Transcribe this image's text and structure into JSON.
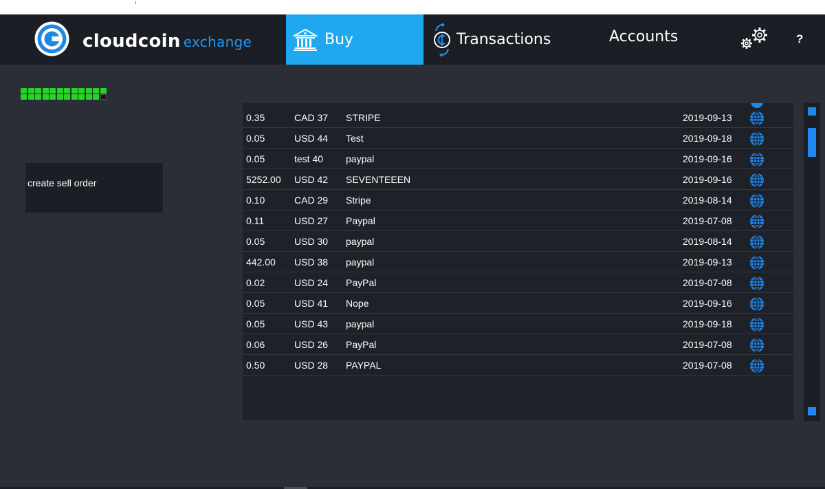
{
  "brand": {
    "name": "cloudcoin",
    "sub": "exchange"
  },
  "nav": {
    "buy_label": "Buy",
    "transactions_label": "Transactions",
    "accounts_label": "Accounts",
    "help_label": "?"
  },
  "icons": {
    "logo": "cloudcoin-logo-icon",
    "buy": "bank-icon",
    "transactions": "coin-exchange-icon",
    "settings": "gear-icon",
    "row_action": "globe-icon"
  },
  "colors": {
    "accent": "#1fa7f0",
    "navbar": "#1b1e25",
    "background": "#2b2e37",
    "progress": "#22d623"
  },
  "progress": {
    "filled": 23,
    "total": 24
  },
  "sell_order": {
    "label": "create sell order"
  },
  "orders": [
    {
      "amount": "0.35",
      "currency": "CAD 37",
      "method": "STRIPE",
      "date": "2019-09-13"
    },
    {
      "amount": "0.05",
      "currency": "USD 44",
      "method": "Test",
      "date": "2019-09-18"
    },
    {
      "amount": "0.05",
      "currency": "test  40",
      "method": "paypal",
      "date": "2019-09-16"
    },
    {
      "amount": "5252.00",
      "currency": "USD 42",
      "method": "SEVENTEEEN",
      "date": "2019-09-16"
    },
    {
      "amount": "0.10",
      "currency": "CAD 29",
      "method": "Stripe",
      "date": "2019-08-14"
    },
    {
      "amount": "0.11",
      "currency": "USD 27",
      "method": "Paypal",
      "date": "2019-07-08"
    },
    {
      "amount": "0.05",
      "currency": "USD 30",
      "method": "paypal",
      "date": "2019-08-14"
    },
    {
      "amount": "442.00",
      "currency": "USD 38",
      "method": "paypal",
      "date": "2019-09-13"
    },
    {
      "amount": "0.02",
      "currency": "USD 24",
      "method": "PayPal",
      "date": "2019-07-08"
    },
    {
      "amount": "0.05",
      "currency": "USD 41",
      "method": "Nope",
      "date": "2019-09-16"
    },
    {
      "amount": "0.05",
      "currency": "USD 43",
      "method": "paypal",
      "date": "2019-09-18"
    },
    {
      "amount": "0.06",
      "currency": "USD 26",
      "method": "PayPal",
      "date": "2019-07-08"
    },
    {
      "amount": "0.50",
      "currency": "USD 28",
      "method": "PAYPAL",
      "date": "2019-07-08"
    }
  ]
}
